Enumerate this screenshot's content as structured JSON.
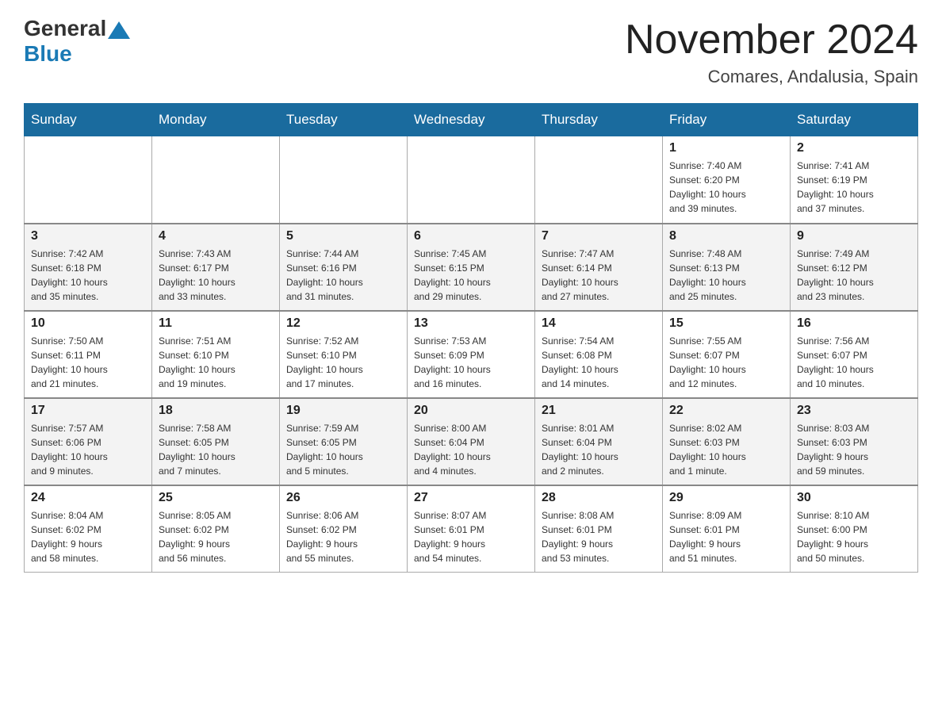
{
  "logo": {
    "general": "General",
    "blue": "Blue"
  },
  "title": "November 2024",
  "subtitle": "Comares, Andalusia, Spain",
  "headers": [
    "Sunday",
    "Monday",
    "Tuesday",
    "Wednesday",
    "Thursday",
    "Friday",
    "Saturday"
  ],
  "weeks": [
    {
      "days": [
        {
          "number": "",
          "info": ""
        },
        {
          "number": "",
          "info": ""
        },
        {
          "number": "",
          "info": ""
        },
        {
          "number": "",
          "info": ""
        },
        {
          "number": "",
          "info": ""
        },
        {
          "number": "1",
          "info": "Sunrise: 7:40 AM\nSunset: 6:20 PM\nDaylight: 10 hours\nand 39 minutes."
        },
        {
          "number": "2",
          "info": "Sunrise: 7:41 AM\nSunset: 6:19 PM\nDaylight: 10 hours\nand 37 minutes."
        }
      ]
    },
    {
      "days": [
        {
          "number": "3",
          "info": "Sunrise: 7:42 AM\nSunset: 6:18 PM\nDaylight: 10 hours\nand 35 minutes."
        },
        {
          "number": "4",
          "info": "Sunrise: 7:43 AM\nSunset: 6:17 PM\nDaylight: 10 hours\nand 33 minutes."
        },
        {
          "number": "5",
          "info": "Sunrise: 7:44 AM\nSunset: 6:16 PM\nDaylight: 10 hours\nand 31 minutes."
        },
        {
          "number": "6",
          "info": "Sunrise: 7:45 AM\nSunset: 6:15 PM\nDaylight: 10 hours\nand 29 minutes."
        },
        {
          "number": "7",
          "info": "Sunrise: 7:47 AM\nSunset: 6:14 PM\nDaylight: 10 hours\nand 27 minutes."
        },
        {
          "number": "8",
          "info": "Sunrise: 7:48 AM\nSunset: 6:13 PM\nDaylight: 10 hours\nand 25 minutes."
        },
        {
          "number": "9",
          "info": "Sunrise: 7:49 AM\nSunset: 6:12 PM\nDaylight: 10 hours\nand 23 minutes."
        }
      ]
    },
    {
      "days": [
        {
          "number": "10",
          "info": "Sunrise: 7:50 AM\nSunset: 6:11 PM\nDaylight: 10 hours\nand 21 minutes."
        },
        {
          "number": "11",
          "info": "Sunrise: 7:51 AM\nSunset: 6:10 PM\nDaylight: 10 hours\nand 19 minutes."
        },
        {
          "number": "12",
          "info": "Sunrise: 7:52 AM\nSunset: 6:10 PM\nDaylight: 10 hours\nand 17 minutes."
        },
        {
          "number": "13",
          "info": "Sunrise: 7:53 AM\nSunset: 6:09 PM\nDaylight: 10 hours\nand 16 minutes."
        },
        {
          "number": "14",
          "info": "Sunrise: 7:54 AM\nSunset: 6:08 PM\nDaylight: 10 hours\nand 14 minutes."
        },
        {
          "number": "15",
          "info": "Sunrise: 7:55 AM\nSunset: 6:07 PM\nDaylight: 10 hours\nand 12 minutes."
        },
        {
          "number": "16",
          "info": "Sunrise: 7:56 AM\nSunset: 6:07 PM\nDaylight: 10 hours\nand 10 minutes."
        }
      ]
    },
    {
      "days": [
        {
          "number": "17",
          "info": "Sunrise: 7:57 AM\nSunset: 6:06 PM\nDaylight: 10 hours\nand 9 minutes."
        },
        {
          "number": "18",
          "info": "Sunrise: 7:58 AM\nSunset: 6:05 PM\nDaylight: 10 hours\nand 7 minutes."
        },
        {
          "number": "19",
          "info": "Sunrise: 7:59 AM\nSunset: 6:05 PM\nDaylight: 10 hours\nand 5 minutes."
        },
        {
          "number": "20",
          "info": "Sunrise: 8:00 AM\nSunset: 6:04 PM\nDaylight: 10 hours\nand 4 minutes."
        },
        {
          "number": "21",
          "info": "Sunrise: 8:01 AM\nSunset: 6:04 PM\nDaylight: 10 hours\nand 2 minutes."
        },
        {
          "number": "22",
          "info": "Sunrise: 8:02 AM\nSunset: 6:03 PM\nDaylight: 10 hours\nand 1 minute."
        },
        {
          "number": "23",
          "info": "Sunrise: 8:03 AM\nSunset: 6:03 PM\nDaylight: 9 hours\nand 59 minutes."
        }
      ]
    },
    {
      "days": [
        {
          "number": "24",
          "info": "Sunrise: 8:04 AM\nSunset: 6:02 PM\nDaylight: 9 hours\nand 58 minutes."
        },
        {
          "number": "25",
          "info": "Sunrise: 8:05 AM\nSunset: 6:02 PM\nDaylight: 9 hours\nand 56 minutes."
        },
        {
          "number": "26",
          "info": "Sunrise: 8:06 AM\nSunset: 6:02 PM\nDaylight: 9 hours\nand 55 minutes."
        },
        {
          "number": "27",
          "info": "Sunrise: 8:07 AM\nSunset: 6:01 PM\nDaylight: 9 hours\nand 54 minutes."
        },
        {
          "number": "28",
          "info": "Sunrise: 8:08 AM\nSunset: 6:01 PM\nDaylight: 9 hours\nand 53 minutes."
        },
        {
          "number": "29",
          "info": "Sunrise: 8:09 AM\nSunset: 6:01 PM\nDaylight: 9 hours\nand 51 minutes."
        },
        {
          "number": "30",
          "info": "Sunrise: 8:10 AM\nSunset: 6:00 PM\nDaylight: 9 hours\nand 50 minutes."
        }
      ]
    }
  ]
}
